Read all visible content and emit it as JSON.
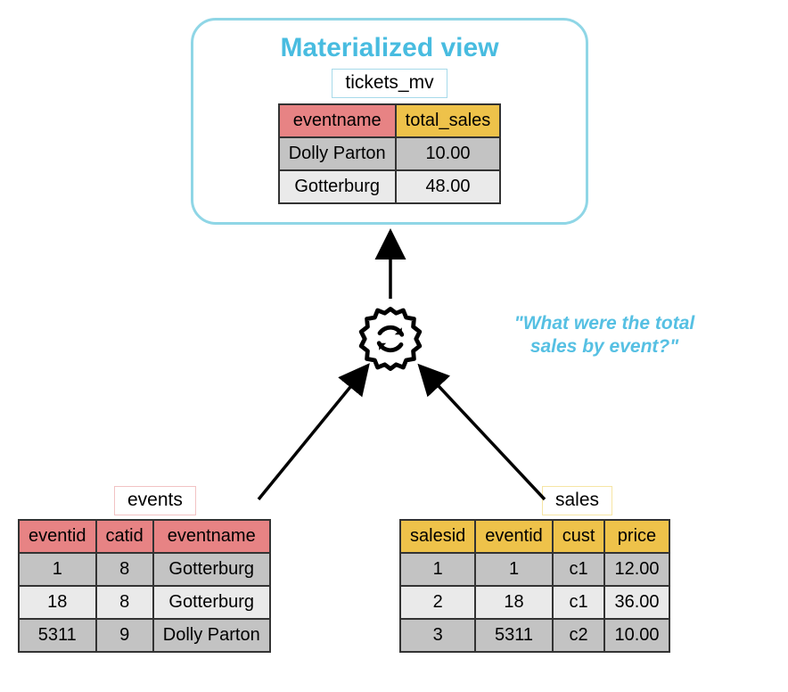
{
  "mv": {
    "title": "Materialized view",
    "caption": "tickets_mv",
    "headers": [
      "eventname",
      "total_sales"
    ],
    "rows": [
      [
        "Dolly Parton",
        "10.00"
      ],
      [
        "Gotterburg",
        "48.00"
      ]
    ]
  },
  "events": {
    "caption": "events",
    "headers": [
      "eventid",
      "catid",
      "eventname"
    ],
    "rows": [
      [
        "1",
        "8",
        "Gotterburg"
      ],
      [
        "18",
        "8",
        "Gotterburg"
      ],
      [
        "5311",
        "9",
        "Dolly Parton"
      ]
    ]
  },
  "sales": {
    "caption": "sales",
    "headers": [
      "salesid",
      "eventid",
      "cust",
      "price"
    ],
    "rows": [
      [
        "1",
        "1",
        "c1",
        "12.00"
      ],
      [
        "2",
        "18",
        "c1",
        "36.00"
      ],
      [
        "3",
        "5311",
        "c2",
        "10.00"
      ]
    ]
  },
  "quote": "\"What were the total sales by event?\"",
  "colors": {
    "blue": "#48bce0",
    "red": "#e78384",
    "yellow": "#eec24a"
  }
}
